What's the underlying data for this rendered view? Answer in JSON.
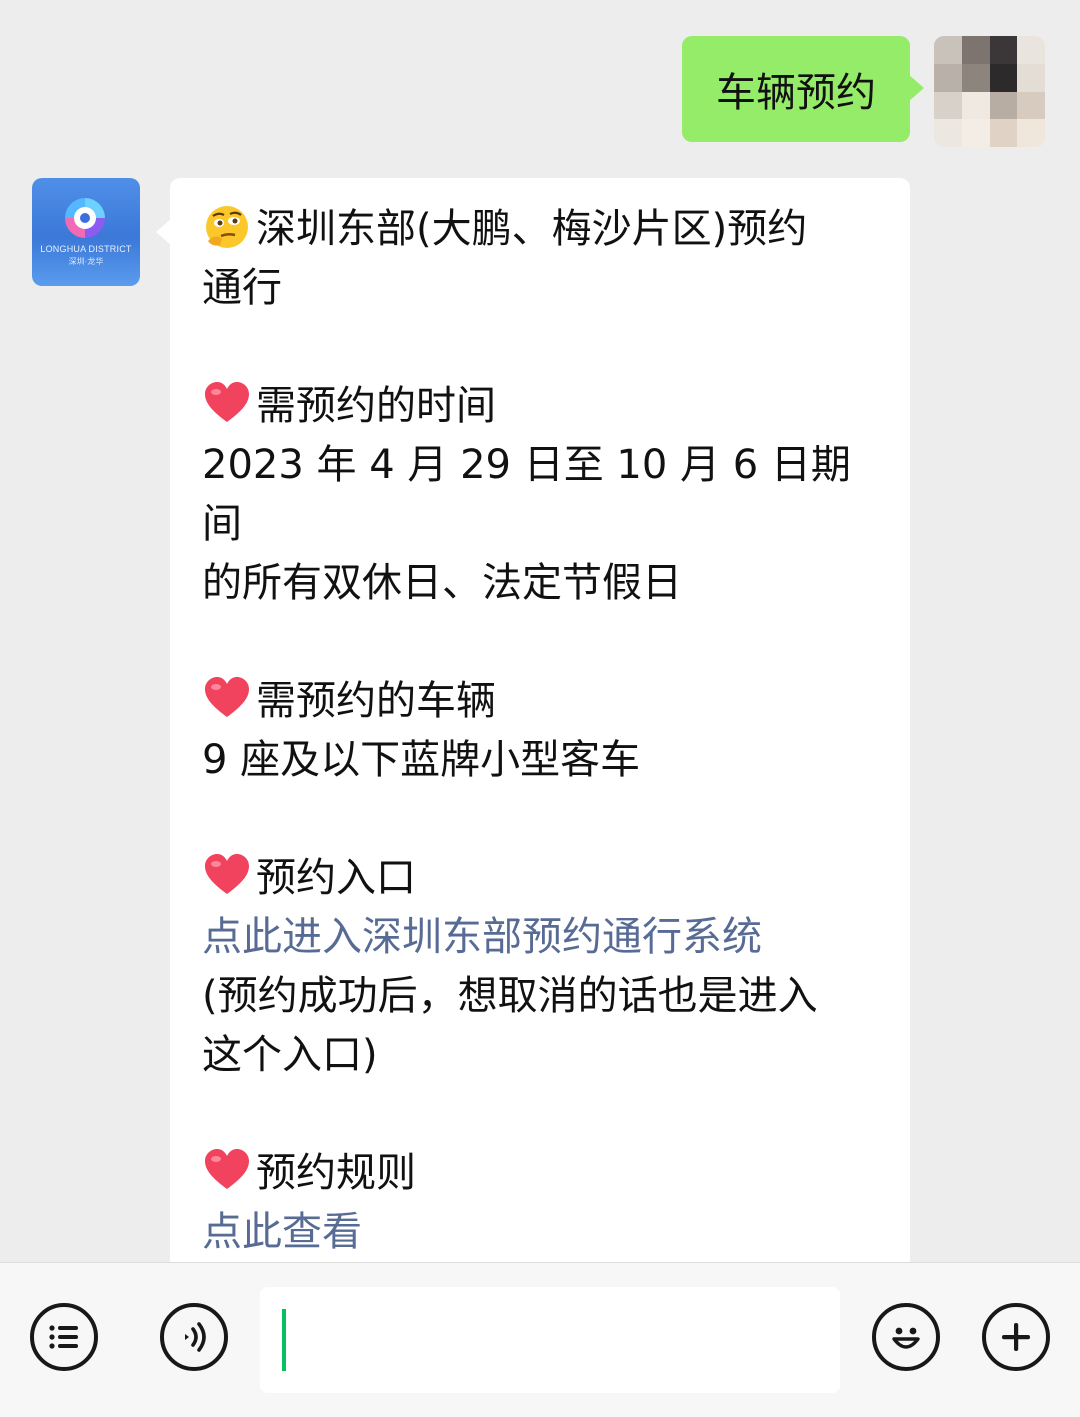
{
  "outgoing": {
    "text": "车辆预约"
  },
  "bot_avatar": {
    "logo_text": "LONGHUA DISTRICT",
    "logo_sub": "深圳·龙华"
  },
  "incoming": {
    "title_lines": [
      "深圳东部(大鹏、梅沙片区)预约",
      "通行"
    ],
    "sections": [
      {
        "heading": "需预约的时间",
        "lines": [
          "2023 年 4 月 29 日至 10 月 6 日期间",
          "的所有双休日、法定节假日"
        ]
      },
      {
        "heading": "需预约的车辆",
        "lines": [
          "9 座及以下蓝牌小型客车"
        ]
      },
      {
        "heading": "预约入口",
        "link": "点此进入深圳东部预约通行系统",
        "lines": [
          "(预约成功后，想取消的话也是进入",
          "这个入口)"
        ]
      },
      {
        "heading": "预约规则",
        "link": "点此查看"
      }
    ]
  },
  "colors": {
    "outgoing_bubble": "#95ec69",
    "link": "#576b95",
    "caret": "#07c160",
    "background": "#ededed"
  },
  "icons": {
    "title_emoji": "thinking-face-icon",
    "section_emoji": "heart-icon",
    "menu": "list-menu-icon",
    "voice": "voice-icon",
    "emoji_button": "smiley-icon",
    "more": "plus-icon"
  },
  "input": {
    "value": ""
  }
}
